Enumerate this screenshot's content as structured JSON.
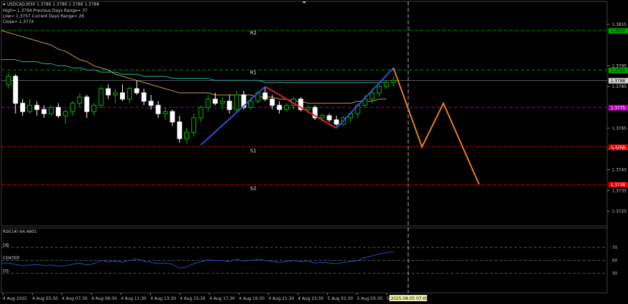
{
  "header": {
    "symbol_line": "USDCAD,M30  1.3786 1.3786 1.3786 1.3788",
    "high_line": "High= 1.3794      Previous Days Range= 37",
    "low_line": "Low= 1.3757      Current Days Range= 26",
    "close_line": "Close= 1.3774"
  },
  "levels": [
    {
      "name": "R2",
      "value": 1.3812,
      "label": "1.3812",
      "color": "#00c000",
      "tag_bg": "#00a000",
      "tag_fg": "#000000"
    },
    {
      "name": "R1",
      "value": 1.3793,
      "label": "1.3793",
      "color": "#00c000",
      "tag_bg": "#00a000",
      "tag_fg": "#000000"
    },
    {
      "name": "S1",
      "value": 1.3756,
      "label": "1.3756",
      "color": "#e00000",
      "tag_bg": "#e00000",
      "tag_fg": "#ffffff"
    },
    {
      "name": "S2",
      "value": 1.3738,
      "label": "1.3738",
      "color": "#e00000",
      "tag_bg": "#e00000",
      "tag_fg": "#ffffff"
    }
  ],
  "pivot": {
    "value": 1.3775,
    "label": "1.3775",
    "color": "#c000c0",
    "tag_bg": "#c000c0",
    "tag_fg": "#ffffff"
  },
  "current_price": {
    "value": 1.3788,
    "label": "1.3788"
  },
  "colors": {
    "bull": "#00c000",
    "bear": "#ffffff",
    "ma_slow": "#20b2aa",
    "ma_fast": "#c8a050",
    "zz_up": "#3050e0",
    "zz_down": "#e02020",
    "forecast": "#f08020",
    "rsi": "#2050d0"
  },
  "chart_data": {
    "type": "candlestick",
    "title": "USDCAD,M30",
    "ylim": [
      1.3718,
      1.3826
    ],
    "y_ticks": [
      1.3815,
      1.3795,
      1.3785,
      1.3765,
      1.3755,
      1.3745,
      1.3735,
      1.3725
    ],
    "x_ticks": [
      "4 Aug 2025",
      "4 Aug 05:30",
      "4 Aug 07:30",
      "4 Aug 09:30",
      "4 Aug 11:30",
      "4 Aug 13:30",
      "4 Aug 15:30",
      "4 Aug 17:30",
      "4 Aug 19:30",
      "4 Aug 21:30",
      "4 Aug 23:30",
      "5 Aug 01:30",
      "5 Aug 03:30",
      "5"
    ],
    "current_time_label": "2025.08.05 07:00",
    "candles": [
      [
        1.3786,
        1.3792,
        1.3784,
        1.379
      ],
      [
        1.379,
        1.3791,
        1.3772,
        1.3777
      ],
      [
        1.3777,
        1.3779,
        1.3771,
        1.3773
      ],
      [
        1.3773,
        1.3779,
        1.3772,
        1.3776
      ],
      [
        1.3776,
        1.3778,
        1.3771,
        1.3774
      ],
      [
        1.3774,
        1.3776,
        1.377,
        1.3772
      ],
      [
        1.3772,
        1.3776,
        1.3771,
        1.3775
      ],
      [
        1.3775,
        1.3777,
        1.377,
        1.3771
      ],
      [
        1.3771,
        1.3774,
        1.3767,
        1.3773
      ],
      [
        1.3773,
        1.3778,
        1.3771,
        1.3777
      ],
      [
        1.3777,
        1.3782,
        1.3775,
        1.378
      ],
      [
        1.378,
        1.3781,
        1.377,
        1.3773
      ],
      [
        1.3773,
        1.3777,
        1.3771,
        1.3776
      ],
      [
        1.3776,
        1.3785,
        1.3775,
        1.3784
      ],
      [
        1.3784,
        1.3786,
        1.3779,
        1.3781
      ],
      [
        1.3781,
        1.3784,
        1.3777,
        1.3782
      ],
      [
        1.3782,
        1.3786,
        1.3778,
        1.3779
      ],
      [
        1.3779,
        1.3785,
        1.3777,
        1.3784
      ],
      [
        1.3784,
        1.3788,
        1.3781,
        1.3782
      ],
      [
        1.3782,
        1.3784,
        1.3776,
        1.3778
      ],
      [
        1.3778,
        1.3781,
        1.3774,
        1.3776
      ],
      [
        1.3776,
        1.3778,
        1.377,
        1.3772
      ],
      [
        1.3772,
        1.3775,
        1.3769,
        1.3773
      ],
      [
        1.3773,
        1.3774,
        1.3766,
        1.3768
      ],
      [
        1.3768,
        1.3771,
        1.3758,
        1.376
      ],
      [
        1.376,
        1.3765,
        1.3758,
        1.3763
      ],
      [
        1.3763,
        1.3772,
        1.3761,
        1.377
      ],
      [
        1.377,
        1.3776,
        1.3768,
        1.3775
      ],
      [
        1.3775,
        1.3781,
        1.3773,
        1.3779
      ],
      [
        1.3779,
        1.3782,
        1.3776,
        1.3777
      ],
      [
        1.3777,
        1.378,
        1.3774,
        1.3778
      ],
      [
        1.3778,
        1.3781,
        1.3772,
        1.3774
      ],
      [
        1.3774,
        1.3783,
        1.3773,
        1.3781
      ],
      [
        1.3781,
        1.3783,
        1.3774,
        1.3775
      ],
      [
        1.3775,
        1.378,
        1.3774,
        1.3778
      ],
      [
        1.3778,
        1.3783,
        1.3777,
        1.3782
      ],
      [
        1.3782,
        1.3785,
        1.3778,
        1.3779
      ],
      [
        1.3779,
        1.3781,
        1.3774,
        1.3776
      ],
      [
        1.3776,
        1.3778,
        1.3772,
        1.3774
      ],
      [
        1.3774,
        1.3777,
        1.3773,
        1.3776
      ],
      [
        1.3776,
        1.378,
        1.3774,
        1.3779
      ],
      [
        1.3779,
        1.378,
        1.3773,
        1.3774
      ],
      [
        1.3774,
        1.3776,
        1.3772,
        1.3775
      ],
      [
        1.3775,
        1.3776,
        1.3769,
        1.377
      ],
      [
        1.377,
        1.3772,
        1.3768,
        1.3771
      ],
      [
        1.3771,
        1.3772,
        1.3768,
        1.3769
      ],
      [
        1.3769,
        1.3771,
        1.3766,
        1.3767
      ],
      [
        1.3767,
        1.3771,
        1.3766,
        1.377
      ],
      [
        1.377,
        1.3773,
        1.3768,
        1.3772
      ],
      [
        1.3772,
        1.3777,
        1.377,
        1.3776
      ],
      [
        1.3776,
        1.3781,
        1.3775,
        1.3779
      ],
      [
        1.3779,
        1.3784,
        1.3777,
        1.3782
      ],
      [
        1.3782,
        1.3786,
        1.378,
        1.3785
      ],
      [
        1.3785,
        1.3788,
        1.3784,
        1.3787
      ],
      [
        1.3787,
        1.379,
        1.3785,
        1.3788
      ]
    ],
    "ma_slow": [
      1.3798,
      1.3798,
      1.3798,
      1.3797,
      1.3797,
      1.3797,
      1.3796,
      1.3796,
      1.3795,
      1.3795,
      1.3794,
      1.3794,
      1.3793,
      1.3793,
      1.3792,
      1.3792,
      1.3792,
      1.3791,
      1.3791,
      1.3791,
      1.379,
      1.379,
      1.379,
      1.379,
      1.3789,
      1.3789,
      1.3789,
      1.3789,
      1.3789,
      1.3789,
      1.3788,
      1.3788,
      1.3788,
      1.3788,
      1.3788,
      1.3788,
      1.3788,
      1.3787,
      1.3787,
      1.3787,
      1.3787,
      1.3787,
      1.3787,
      1.3787,
      1.3787,
      1.3787,
      1.3787,
      1.3787,
      1.3787,
      1.3787,
      1.3787,
      1.3787,
      1.3787,
      1.3787,
      1.3787
    ],
    "ma_fast": [
      1.3812,
      1.3811,
      1.381,
      1.3809,
      1.3808,
      1.3807,
      1.3806,
      1.3805,
      1.3803,
      1.3802,
      1.38,
      1.3798,
      1.3797,
      1.3795,
      1.3794,
      1.3793,
      1.3791,
      1.379,
      1.3789,
      1.3788,
      1.3787,
      1.3786,
      1.3785,
      1.3784,
      1.3783,
      1.3782,
      1.3782,
      1.3782,
      1.3782,
      1.3782,
      1.3781,
      1.3781,
      1.3781,
      1.3781,
      1.3781,
      1.3781,
      1.378,
      1.378,
      1.378,
      1.3779,
      1.3779,
      1.3778,
      1.3778,
      1.3777,
      1.3777,
      1.3777,
      1.3777,
      1.3777,
      1.3777,
      1.3777,
      1.3778,
      1.3778,
      1.3778,
      1.3779,
      1.3779
    ],
    "zigzag": [
      [
        27,
        1.3757
      ],
      [
        36,
        1.3785
      ],
      [
        46,
        1.3765
      ],
      [
        54,
        1.3794
      ]
    ],
    "forecast": [
      [
        54,
        1.3794
      ],
      [
        58,
        1.3756
      ],
      [
        61,
        1.3777
      ],
      [
        66,
        1.3738
      ]
    ],
    "rsi": {
      "label": "RSI(14) 64.4601",
      "levels": [
        {
          "name": "OB",
          "value": 70
        },
        {
          "name": "CENTER",
          "value": 50
        },
        {
          "name": "OS",
          "value": 30
        }
      ],
      "y_ticks": [
        70,
        50,
        30
      ],
      "ylim": [
        0,
        100
      ],
      "values": [
        46,
        44,
        42,
        43,
        44,
        42,
        43,
        41,
        42,
        44,
        46,
        43,
        45,
        50,
        48,
        49,
        47,
        50,
        52,
        49,
        47,
        45,
        46,
        44,
        38,
        40,
        45,
        48,
        51,
        50,
        50,
        48,
        52,
        49,
        50,
        52,
        50,
        48,
        47,
        48,
        50,
        48,
        49,
        46,
        47,
        46,
        45,
        47,
        48,
        50,
        54,
        57,
        60,
        62,
        64
      ]
    }
  }
}
